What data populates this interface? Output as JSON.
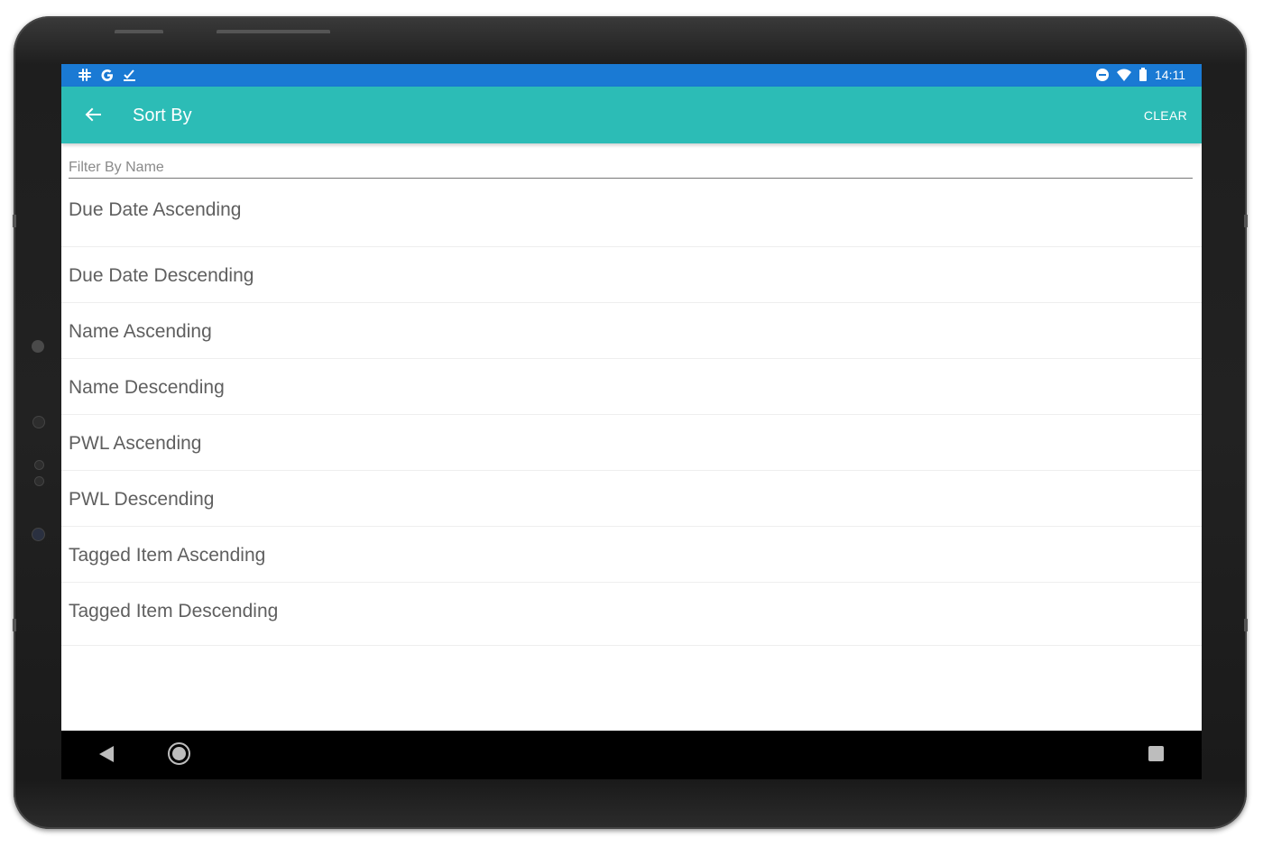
{
  "status_bar": {
    "time": "14:11",
    "left_icons": [
      "slack-icon",
      "google-icon",
      "tasks-icon"
    ],
    "right_icons": [
      "do-not-disturb-icon",
      "wifi-icon",
      "battery-icon"
    ]
  },
  "app_bar": {
    "title": "Sort By",
    "clear_label": "CLEAR",
    "background": "#2cbcb6"
  },
  "filter": {
    "placeholder": "Filter By Name",
    "value": ""
  },
  "sort_options": [
    {
      "label": "Due Date Ascending"
    },
    {
      "label": "Due Date Descending"
    },
    {
      "label": "Name Ascending"
    },
    {
      "label": "Name Descending"
    },
    {
      "label": "PWL Ascending"
    },
    {
      "label": "PWL Descending"
    },
    {
      "label": "Tagged Item Ascending"
    },
    {
      "label": "Tagged Item Descending"
    }
  ],
  "nav_bar": {
    "buttons": [
      "back-icon",
      "home-icon",
      "recents-icon"
    ]
  },
  "colors": {
    "status_bar": "#1a7ad4",
    "accent": "#2cbcb6",
    "text": "#5f5f5f"
  }
}
